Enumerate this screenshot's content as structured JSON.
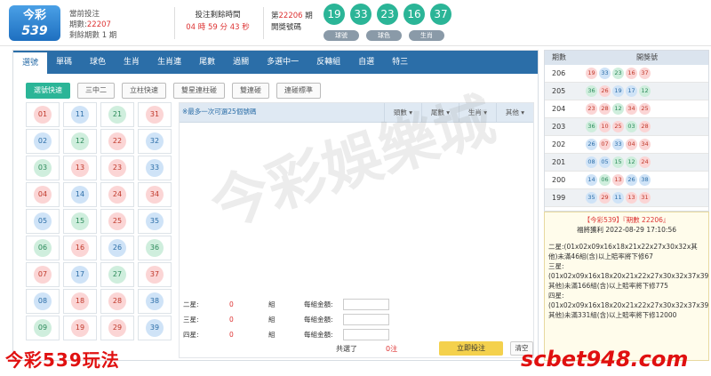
{
  "header": {
    "logo_line1": "今彩",
    "logo_line2": "539",
    "current_label": "當前投注",
    "current_period_prefix": "期數:",
    "current_period": "22207",
    "remaining_text": "剩餘期數 1 期",
    "close_label": "投注剩餘時間",
    "close_time": "04 時 59 分 43 秒",
    "prev_period_prefix": "第",
    "prev_period": "22206",
    "prev_period_suffix": " 期",
    "prev_label": "開獎號碼",
    "draw_balls": [
      "19",
      "33",
      "23",
      "16",
      "37"
    ],
    "draw_buttons": [
      "球號",
      "球色",
      "生肖"
    ]
  },
  "tabs": [
    "選號",
    "單碼",
    "球色",
    "生肖",
    "生肖連",
    "尾數",
    "過關",
    "多選中一",
    "反轉組",
    "自選",
    "特三"
  ],
  "sub_buttons": [
    "選號快速",
    "三中二",
    "立柱快速",
    "雙星連柱碰",
    "雙連碰",
    "連碰標準"
  ],
  "number_grid": [
    {
      "n": "01",
      "c": "red"
    },
    {
      "n": "11",
      "c": "blue"
    },
    {
      "n": "21",
      "c": "green"
    },
    {
      "n": "31",
      "c": "red"
    },
    {
      "n": "02",
      "c": "blue"
    },
    {
      "n": "12",
      "c": "green"
    },
    {
      "n": "22",
      "c": "red"
    },
    {
      "n": "32",
      "c": "blue"
    },
    {
      "n": "03",
      "c": "green"
    },
    {
      "n": "13",
      "c": "red"
    },
    {
      "n": "23",
      "c": "red"
    },
    {
      "n": "33",
      "c": "blue"
    },
    {
      "n": "04",
      "c": "red"
    },
    {
      "n": "14",
      "c": "blue"
    },
    {
      "n": "24",
      "c": "red"
    },
    {
      "n": "34",
      "c": "red"
    },
    {
      "n": "05",
      "c": "blue"
    },
    {
      "n": "15",
      "c": "green"
    },
    {
      "n": "25",
      "c": "red"
    },
    {
      "n": "35",
      "c": "blue"
    },
    {
      "n": "06",
      "c": "green"
    },
    {
      "n": "16",
      "c": "red"
    },
    {
      "n": "26",
      "c": "blue"
    },
    {
      "n": "36",
      "c": "green"
    },
    {
      "n": "07",
      "c": "red"
    },
    {
      "n": "17",
      "c": "blue"
    },
    {
      "n": "27",
      "c": "green"
    },
    {
      "n": "37",
      "c": "red"
    },
    {
      "n": "08",
      "c": "blue"
    },
    {
      "n": "18",
      "c": "red"
    },
    {
      "n": "28",
      "c": "red"
    },
    {
      "n": "38",
      "c": "blue"
    },
    {
      "n": "09",
      "c": "green"
    },
    {
      "n": "19",
      "c": "red"
    },
    {
      "n": "29",
      "c": "red"
    },
    {
      "n": "39",
      "c": "blue"
    }
  ],
  "bet": {
    "hint": "※最多一次可選25個號碼",
    "columns": [
      "頭數",
      "尾數",
      "生肖",
      "其他"
    ],
    "rows": [
      {
        "label": "二星:",
        "value": "0",
        "unit": "組",
        "amount_label": "每組金額:"
      },
      {
        "label": "三星:",
        "value": "0",
        "unit": "組",
        "amount_label": "每組金額:"
      },
      {
        "label": "四星:",
        "value": "0",
        "unit": "組",
        "amount_label": "每組金額:"
      }
    ],
    "total_label": "共選了",
    "total_value": "0注",
    "submit_label": "立即投注",
    "clear_label": "清空"
  },
  "history": {
    "col_period": "期數",
    "col_numbers": "開獎號",
    "rows": [
      {
        "p": "206",
        "b": [
          [
            "19",
            "red"
          ],
          [
            "33",
            "blue"
          ],
          [
            "23",
            "green"
          ],
          [
            "16",
            "red"
          ],
          [
            "37",
            "red"
          ]
        ]
      },
      {
        "p": "205",
        "b": [
          [
            "36",
            "green"
          ],
          [
            "26",
            "red"
          ],
          [
            "19",
            "blue"
          ],
          [
            "17",
            "blue"
          ],
          [
            "12",
            "green"
          ]
        ]
      },
      {
        "p": "204",
        "b": [
          [
            "23",
            "red"
          ],
          [
            "28",
            "red"
          ],
          [
            "12",
            "green"
          ],
          [
            "34",
            "red"
          ],
          [
            "25",
            "red"
          ]
        ]
      },
      {
        "p": "203",
        "b": [
          [
            "36",
            "green"
          ],
          [
            "10",
            "red"
          ],
          [
            "25",
            "red"
          ],
          [
            "03",
            "green"
          ],
          [
            "28",
            "red"
          ]
        ]
      },
      {
        "p": "202",
        "b": [
          [
            "26",
            "blue"
          ],
          [
            "07",
            "red"
          ],
          [
            "33",
            "blue"
          ],
          [
            "04",
            "red"
          ],
          [
            "34",
            "red"
          ]
        ]
      },
      {
        "p": "201",
        "b": [
          [
            "08",
            "blue"
          ],
          [
            "05",
            "blue"
          ],
          [
            "15",
            "green"
          ],
          [
            "12",
            "green"
          ],
          [
            "24",
            "red"
          ]
        ]
      },
      {
        "p": "200",
        "b": [
          [
            "14",
            "blue"
          ],
          [
            "06",
            "green"
          ],
          [
            "13",
            "red"
          ],
          [
            "26",
            "blue"
          ],
          [
            "38",
            "blue"
          ]
        ]
      },
      {
        "p": "199",
        "b": [
          [
            "35",
            "blue"
          ],
          [
            "29",
            "red"
          ],
          [
            "11",
            "blue"
          ],
          [
            "13",
            "red"
          ],
          [
            "31",
            "red"
          ]
        ]
      }
    ]
  },
  "info": {
    "title": "【今彩539】『期數 22206』",
    "time": "福將獲利 2022-08-29 17:10:56",
    "blocks": [
      "二星:(01x02x09x16x18x21x22x27x30x32x其他)未滿46組(含)以上賠率將下修67",
      "三星:(01x02x09x16x18x20x21x22x27x30x32x37x39x其他)未滿166組(含)以上賠率將下修775",
      "四星:(01x02x09x16x18x20x21x22x27x30x32x37x39x其他)未滿331組(含)以上賠率將下修12000"
    ]
  },
  "overlay": {
    "caption": "今彩539玩法",
    "watermark": "今彩娛樂城",
    "brand": "scbet948.com"
  }
}
